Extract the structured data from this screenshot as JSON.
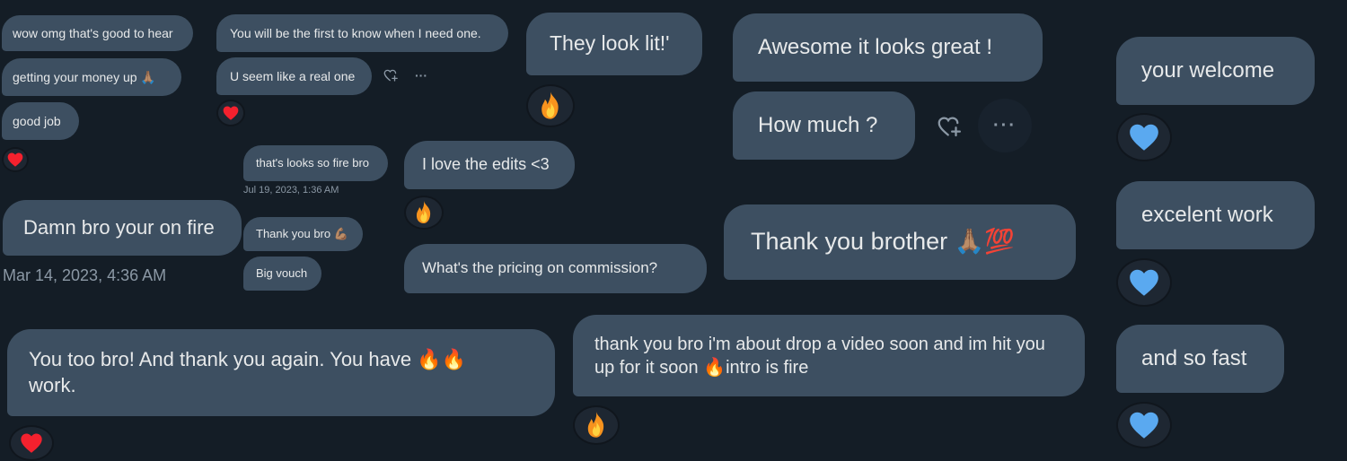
{
  "colors": {
    "background": "#141d26",
    "bubble": "#3d4f61",
    "text": "#e7e9ea",
    "timestamp": "#8b98a5",
    "heart_red": "#f4212e",
    "heart_blue": "#5aa9f0",
    "fire": "#f7931e"
  },
  "messages": {
    "m1": "wow omg that's good to hear",
    "m2": "getting your money up 🙏🏽",
    "m3": "good job",
    "m4": "You will be the first to know when I need one.",
    "m5": "U seem like a real one",
    "m6": "They look lit!'",
    "m7": "Awesome it looks great !",
    "m8": "How much ?",
    "m9": "your welcome",
    "m10": "that's looks so fire bro",
    "m11": "I love the edits <3",
    "m12": "Damn bro your on fire",
    "m13": "Thank you bro 💪🏽",
    "m14": "Big vouch",
    "m15": "What's the pricing on commission?",
    "m16": "Thank you brother 🙏🏽💯",
    "m17": "excelent work",
    "m18": "You too bro! And thank you again. You have 🔥🔥 work.",
    "m19": "thank you bro i'm about drop a video soon and im hit you up for it soon 🔥intro is fire",
    "m20": "and so fast"
  },
  "timestamps": {
    "t1": "Jul 19, 2023, 1:36 AM",
    "t2": "Mar 14, 2023, 4:36 AM"
  },
  "reactions": {
    "red_heart": "red-heart",
    "blue_heart": "blue-heart",
    "fire": "fire"
  },
  "actions": {
    "more_label": "···"
  }
}
